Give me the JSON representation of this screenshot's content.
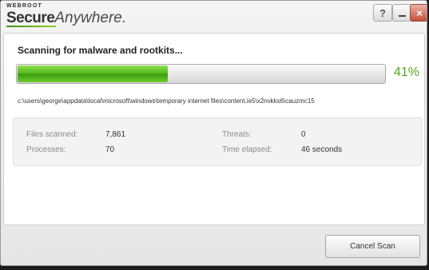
{
  "window": {
    "brand_small": "WEBROOT",
    "brand_secure": "Secure",
    "brand_anywhere": "Anywhere.",
    "controls": {
      "help": "?",
      "close": "×"
    }
  },
  "scan": {
    "heading": "Scanning for malware and rootkits...",
    "progress": 41,
    "progress_label": "41%",
    "current_path": "c:\\users\\george\\appdata\\local\\microsoft\\windows\\temporary internet files\\content.ie5\\x2nvkks6\\cauzmc15"
  },
  "stats": {
    "files_scanned": {
      "label": "Files scanned:",
      "value": "7,861"
    },
    "processes": {
      "label": "Processes:",
      "value": "70"
    },
    "threats": {
      "label": "Threats:",
      "value": "0"
    },
    "time_elapsed": {
      "label": "Time elapsed:",
      "value": "46 seconds"
    }
  },
  "footer": {
    "cancel_label": "Cancel Scan"
  },
  "colors": {
    "accent": "#52a81e",
    "progress": "#4fb61b"
  }
}
